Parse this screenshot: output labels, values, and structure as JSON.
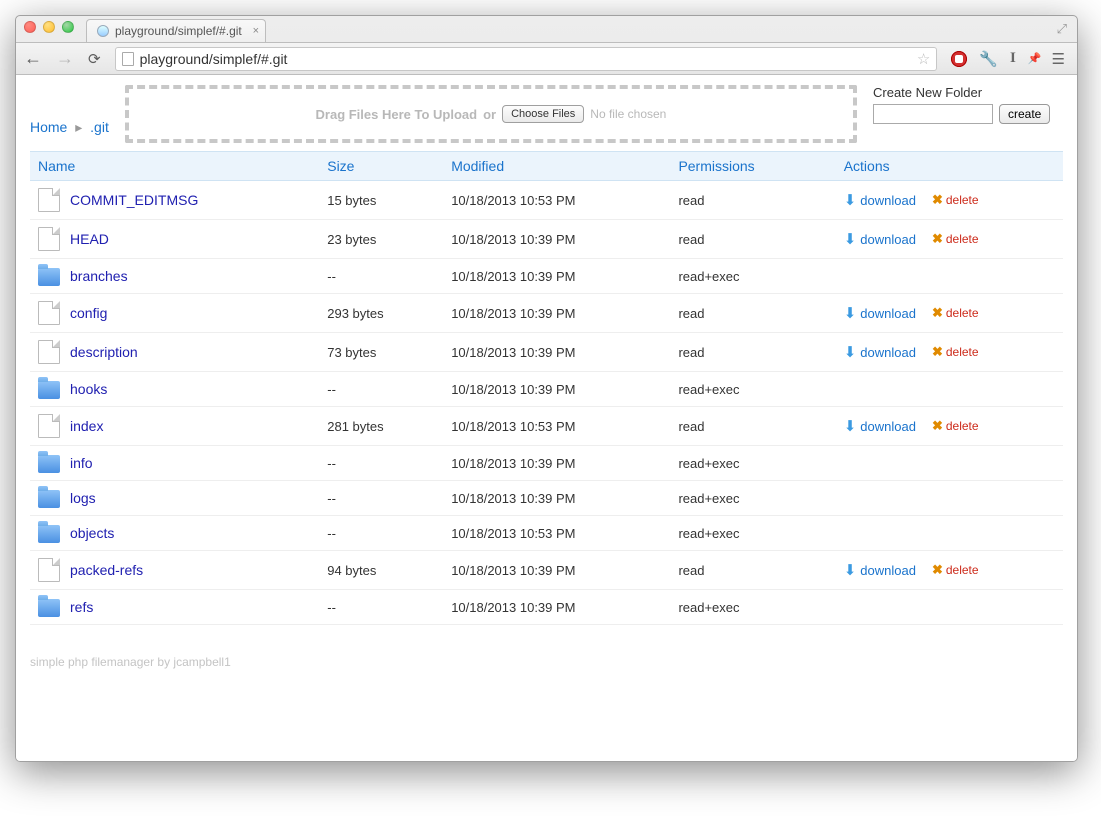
{
  "browser": {
    "tab_title": "playground/simplef/#.git",
    "url": "playground/simplef/#.git"
  },
  "breadcrumb": {
    "home": "Home",
    "current": ".git"
  },
  "upload": {
    "drag_label": "Drag Files Here To Upload",
    "or_label": "or",
    "choose_button": "Choose Files",
    "no_file": "No file chosen"
  },
  "new_folder": {
    "label": "Create New Folder",
    "button": "create"
  },
  "table": {
    "headers": {
      "name": "Name",
      "size": "Size",
      "modified": "Modified",
      "permissions": "Permissions",
      "actions": "Actions"
    }
  },
  "action_labels": {
    "download": "download",
    "delete": "delete"
  },
  "rows": [
    {
      "type": "file",
      "name": "COMMIT_EDITMSG",
      "size": "15 bytes",
      "modified": "10/18/2013 10:53 PM",
      "perm": "read",
      "actions": true
    },
    {
      "type": "file",
      "name": "HEAD",
      "size": "23 bytes",
      "modified": "10/18/2013 10:39 PM",
      "perm": "read",
      "actions": true
    },
    {
      "type": "folder",
      "name": "branches",
      "size": "--",
      "modified": "10/18/2013 10:39 PM",
      "perm": "read+exec",
      "actions": false
    },
    {
      "type": "file",
      "name": "config",
      "size": "293 bytes",
      "modified": "10/18/2013 10:39 PM",
      "perm": "read",
      "actions": true
    },
    {
      "type": "file",
      "name": "description",
      "size": "73 bytes",
      "modified": "10/18/2013 10:39 PM",
      "perm": "read",
      "actions": true
    },
    {
      "type": "folder",
      "name": "hooks",
      "size": "--",
      "modified": "10/18/2013 10:39 PM",
      "perm": "read+exec",
      "actions": false
    },
    {
      "type": "file",
      "name": "index",
      "size": "281 bytes",
      "modified": "10/18/2013 10:53 PM",
      "perm": "read",
      "actions": true
    },
    {
      "type": "folder",
      "name": "info",
      "size": "--",
      "modified": "10/18/2013 10:39 PM",
      "perm": "read+exec",
      "actions": false
    },
    {
      "type": "folder",
      "name": "logs",
      "size": "--",
      "modified": "10/18/2013 10:39 PM",
      "perm": "read+exec",
      "actions": false
    },
    {
      "type": "folder",
      "name": "objects",
      "size": "--",
      "modified": "10/18/2013 10:53 PM",
      "perm": "read+exec",
      "actions": false
    },
    {
      "type": "file",
      "name": "packed-refs",
      "size": "94 bytes",
      "modified": "10/18/2013 10:39 PM",
      "perm": "read",
      "actions": true
    },
    {
      "type": "folder",
      "name": "refs",
      "size": "--",
      "modified": "10/18/2013 10:39 PM",
      "perm": "read+exec",
      "actions": false
    }
  ],
  "footer": "simple php filemanager by jcampbell1"
}
